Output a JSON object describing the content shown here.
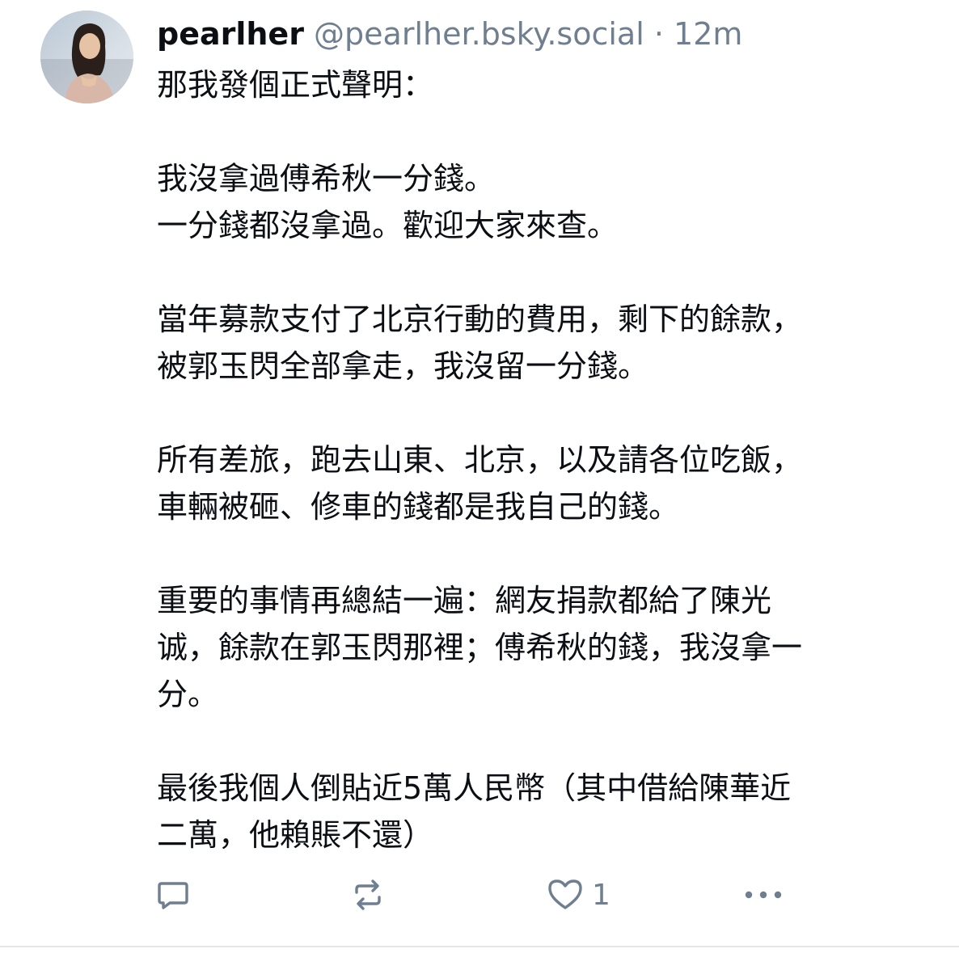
{
  "post": {
    "author": {
      "display_name": "pearlher",
      "handle": "@pearlher.bsky.social"
    },
    "separator": "·",
    "time": "12m",
    "text": "那我發個正式聲明：\n\n我沒拿過傅希秋一分錢。\n一分錢都沒拿過。歡迎大家來查。\n\n當年募款支付了北京行動的費用，剩下的餘款，\n被郭玉閃全部拿走，我沒留一分錢。\n\n所有差旅，跑去山東、北京，以及請各位吃飯，\n車輛被砸、修車的錢都是我自己的錢。\n\n重要的事情再總結一遍：網友捐款都給了陳光\n诚，餘款在郭玉閃那裡；傅希秋的錢，我沒拿一\n分。\n\n最後我個人倒貼近5萬人民幣（其中借給陳華近\n二萬，他賴賬不還）",
    "actions": {
      "reply_icon": "speech-bubble-icon",
      "repost_icon": "repost-arrows-icon",
      "like_icon": "heart-outline-icon",
      "like_count": "1",
      "more_icon": "ellipsis-icon"
    },
    "colors": {
      "text": "#0b0f14",
      "muted": "#6f7f8f",
      "divider": "#e4e8ec"
    }
  }
}
